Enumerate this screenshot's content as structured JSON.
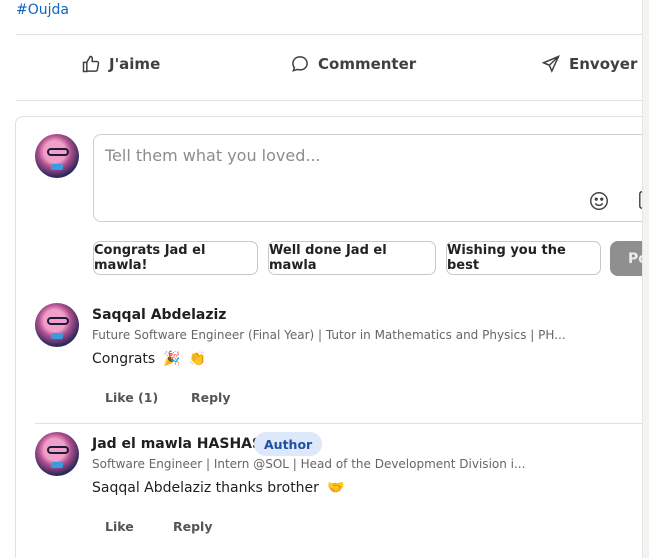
{
  "post": {
    "hashtag": "#Oujda"
  },
  "actions": {
    "like": "J'aime",
    "comment": "Commenter",
    "send": "Envoyer"
  },
  "composer": {
    "placeholder": "Tell them what you loved...",
    "suggestions": [
      "Congrats Jad el mawla!",
      "Well done Jad el mawla",
      "Wishing you the best"
    ],
    "post_label": "Post"
  },
  "comments": [
    {
      "name": "Saqqal Abdelaziz",
      "headline": "Future Software Engineer (Final Year) | Tutor in Mathematics and Physics | PH...",
      "text": "Congrats",
      "emojis": [
        "🎉",
        "👏"
      ],
      "like_label": "Like (1)",
      "reply_label": "Reply"
    },
    {
      "name": "Jad el mawla HASHAS",
      "badge": "Author",
      "headline": "Software Engineer | Intern @SOL | Head of the Development Division i...",
      "text": "Saqqal Abdelaziz thanks brother",
      "emojis": [
        "🤝"
      ],
      "like_label": "Like",
      "reply_label": "Reply"
    }
  ],
  "colors": {
    "link": "#0a66c2",
    "badge_bg": "#dde8fb",
    "badge_text": "#1f4fa3",
    "post_button": "#8f8f8f"
  }
}
